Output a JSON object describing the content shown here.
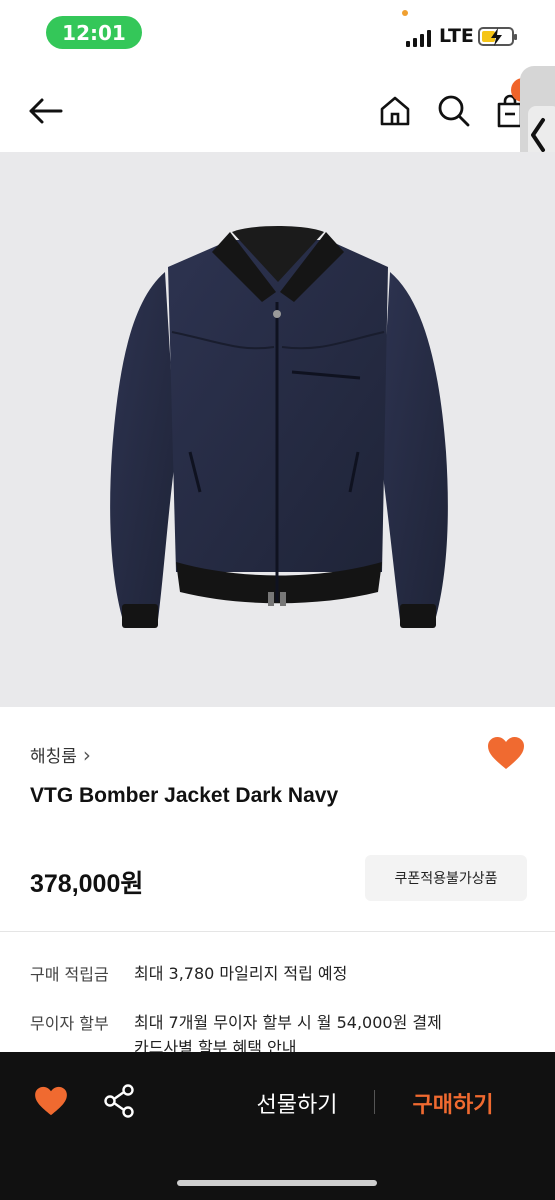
{
  "status_bar": {
    "time": "12:01",
    "network": "LTE"
  },
  "header": {
    "icons": [
      "back-arrow-icon",
      "home-icon",
      "search-icon",
      "shopping-bag-icon",
      "chevron-left-icon"
    ]
  },
  "product": {
    "brand": "해칭룸",
    "brand_chevron": "›",
    "name": "VTG Bomber Jacket Dark Navy",
    "price": "378,000원",
    "coupon_label": "쿠폰적용불가상품",
    "wishlisted": true,
    "image_subject": "jacket-image"
  },
  "info": {
    "rows": [
      {
        "label": "구매 적립금",
        "value": "최대 3,780 마일리지 적립 예정"
      },
      {
        "label": "무이자 할부",
        "value": "최대 7개월 무이자 할부 시 월 54,000원 결제",
        "value2": "카드사별 할부 혜택 안내"
      }
    ]
  },
  "bottom_bar": {
    "gift_label": "선물하기",
    "buy_label": "구매하기"
  },
  "colors": {
    "accent": "#f06a30",
    "status_green": "#34c759",
    "bottom_bar": "#111111"
  }
}
